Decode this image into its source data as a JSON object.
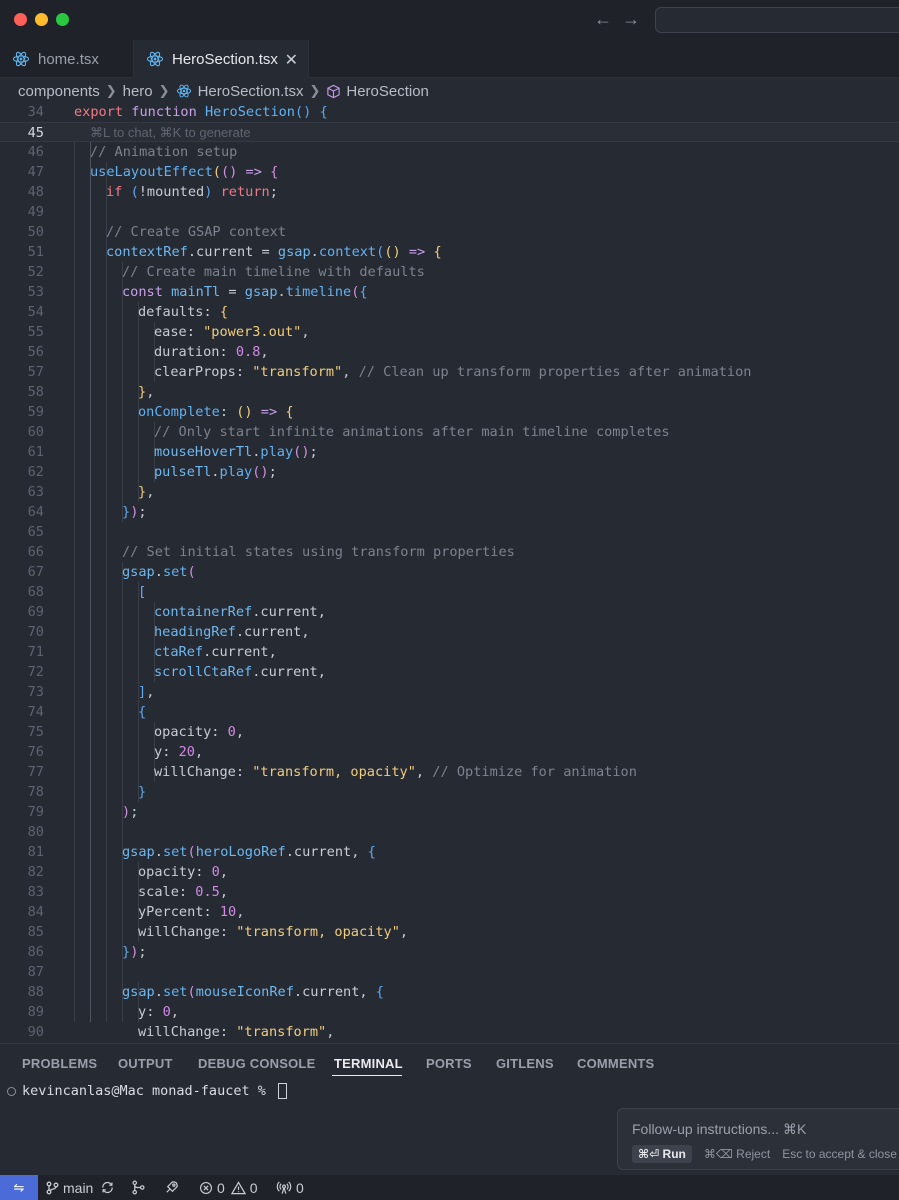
{
  "window": {
    "back_icon": "arrow-left-icon",
    "forward_icon": "arrow-right-icon"
  },
  "tabs": [
    {
      "label": "home.tsx",
      "icon": "react-icon"
    },
    {
      "label": "HeroSection.tsx",
      "icon": "react-icon",
      "close": "✕"
    }
  ],
  "breadcrumb": {
    "items": [
      "components",
      "hero",
      "HeroSection.tsx",
      "HeroSection"
    ]
  },
  "editor": {
    "inline_hint": "⌘L to chat, ⌘K to generate",
    "lines": [
      {
        "n": "34",
        "code": [
          [
            "ex",
            "export "
          ],
          [
            "kw",
            "function "
          ],
          [
            "fn",
            "HeroSection"
          ],
          [
            "br3",
            "() "
          ],
          [
            "br3",
            "{"
          ]
        ]
      },
      {
        "n": "45",
        "hint": true
      },
      {
        "n": "46",
        "code": [
          [
            "cm",
            "// Animation setup"
          ]
        ]
      },
      {
        "n": "47",
        "code": [
          [
            "fn",
            "useLayoutEffect"
          ],
          [
            "br1",
            "("
          ],
          [
            "br2",
            "("
          ],
          [
            "br2",
            ")"
          ],
          [
            "kw",
            " => "
          ],
          [
            "br2",
            "{"
          ]
        ]
      },
      {
        "n": "48",
        "code": [
          [
            "ex",
            "if "
          ],
          [
            "br3",
            "("
          ],
          [
            "pl",
            "!mounted"
          ],
          [
            "br3",
            ") "
          ],
          [
            "ex",
            "return"
          ],
          [
            "pl",
            ";"
          ]
        ]
      },
      {
        "n": "49",
        "code": []
      },
      {
        "n": "50",
        "code": [
          [
            "cm",
            "// Create GSAP context"
          ]
        ]
      },
      {
        "n": "51",
        "code": [
          [
            "va",
            "contextRef"
          ],
          [
            "pl",
            "."
          ],
          [
            "pr",
            "current"
          ],
          [
            "pl",
            " = "
          ],
          [
            "va",
            "gsap"
          ],
          [
            "pl",
            "."
          ],
          [
            "fn",
            "context"
          ],
          [
            "br3",
            "("
          ],
          [
            "br1",
            "("
          ],
          [
            "br1",
            ")"
          ],
          [
            "kw",
            " => "
          ],
          [
            "br1",
            "{"
          ]
        ]
      },
      {
        "n": "52",
        "code": [
          [
            "cm",
            "// Create main timeline with defaults"
          ]
        ]
      },
      {
        "n": "53",
        "code": [
          [
            "kw",
            "const "
          ],
          [
            "va",
            "mainTl"
          ],
          [
            "pl",
            " = "
          ],
          [
            "va",
            "gsap"
          ],
          [
            "pl",
            "."
          ],
          [
            "fn",
            "timeline"
          ],
          [
            "br2",
            "("
          ],
          [
            "br3",
            "{"
          ]
        ]
      },
      {
        "n": "54",
        "code": [
          [
            "pr",
            "defaults"
          ],
          [
            "pl",
            ": "
          ],
          [
            "br1",
            "{"
          ]
        ]
      },
      {
        "n": "55",
        "code": [
          [
            "pr",
            "ease"
          ],
          [
            "pl",
            ": "
          ],
          [
            "st",
            "\"power3.out\""
          ],
          [
            "pl",
            ","
          ]
        ]
      },
      {
        "n": "56",
        "code": [
          [
            "pr",
            "duration"
          ],
          [
            "pl",
            ": "
          ],
          [
            "nu",
            "0.8"
          ],
          [
            "pl",
            ","
          ]
        ]
      },
      {
        "n": "57",
        "code": [
          [
            "pr",
            "clearProps"
          ],
          [
            "pl",
            ": "
          ],
          [
            "st",
            "\"transform\""
          ],
          [
            "pl",
            ", "
          ],
          [
            "cm",
            "// Clean up transform properties after animation"
          ]
        ]
      },
      {
        "n": "58",
        "code": [
          [
            "br1",
            "}"
          ],
          [
            "pl",
            ","
          ]
        ]
      },
      {
        "n": "59",
        "code": [
          [
            "fn",
            "onComplete"
          ],
          [
            "pl",
            ": "
          ],
          [
            "br1",
            "("
          ],
          [
            "br1",
            ")"
          ],
          [
            "kw",
            " => "
          ],
          [
            "br1",
            "{"
          ]
        ]
      },
      {
        "n": "60",
        "code": [
          [
            "cm",
            "// Only start infinite animations after main timeline completes"
          ]
        ]
      },
      {
        "n": "61",
        "code": [
          [
            "va",
            "mouseHoverTl"
          ],
          [
            "pl",
            "."
          ],
          [
            "fn",
            "play"
          ],
          [
            "br2",
            "("
          ],
          [
            "br2",
            ")"
          ],
          [
            "pl",
            ";"
          ]
        ]
      },
      {
        "n": "62",
        "code": [
          [
            "va",
            "pulseTl"
          ],
          [
            "pl",
            "."
          ],
          [
            "fn",
            "play"
          ],
          [
            "br2",
            "("
          ],
          [
            "br2",
            ")"
          ],
          [
            "pl",
            ";"
          ]
        ]
      },
      {
        "n": "63",
        "code": [
          [
            "br1",
            "}"
          ],
          [
            "pl",
            ","
          ]
        ]
      },
      {
        "n": "64",
        "code": [
          [
            "br3",
            "}"
          ],
          [
            "br2",
            ")"
          ],
          [
            "pl",
            ";"
          ]
        ]
      },
      {
        "n": "65",
        "code": []
      },
      {
        "n": "66",
        "code": [
          [
            "cm",
            "// Set initial states using transform properties"
          ]
        ]
      },
      {
        "n": "67",
        "code": [
          [
            "va",
            "gsap"
          ],
          [
            "pl",
            "."
          ],
          [
            "fn",
            "set"
          ],
          [
            "br2",
            "("
          ]
        ]
      },
      {
        "n": "68",
        "code": [
          [
            "br3",
            "["
          ]
        ]
      },
      {
        "n": "69",
        "code": [
          [
            "va",
            "containerRef"
          ],
          [
            "pl",
            "."
          ],
          [
            "pr",
            "current"
          ],
          [
            "pl",
            ","
          ]
        ]
      },
      {
        "n": "70",
        "code": [
          [
            "va",
            "headingRef"
          ],
          [
            "pl",
            "."
          ],
          [
            "pr",
            "current"
          ],
          [
            "pl",
            ","
          ]
        ]
      },
      {
        "n": "71",
        "code": [
          [
            "va",
            "ctaRef"
          ],
          [
            "pl",
            "."
          ],
          [
            "pr",
            "current"
          ],
          [
            "pl",
            ","
          ]
        ]
      },
      {
        "n": "72",
        "code": [
          [
            "va",
            "scrollCtaRef"
          ],
          [
            "pl",
            "."
          ],
          [
            "pr",
            "current"
          ],
          [
            "pl",
            ","
          ]
        ]
      },
      {
        "n": "73",
        "code": [
          [
            "br3",
            "]"
          ],
          [
            "pl",
            ","
          ]
        ]
      },
      {
        "n": "74",
        "code": [
          [
            "br3",
            "{"
          ]
        ]
      },
      {
        "n": "75",
        "code": [
          [
            "pr",
            "opacity"
          ],
          [
            "pl",
            ": "
          ],
          [
            "nu",
            "0"
          ],
          [
            "pl",
            ","
          ]
        ]
      },
      {
        "n": "76",
        "code": [
          [
            "pr",
            "y"
          ],
          [
            "pl",
            ": "
          ],
          [
            "nu",
            "20"
          ],
          [
            "pl",
            ","
          ]
        ]
      },
      {
        "n": "77",
        "code": [
          [
            "pr",
            "willChange"
          ],
          [
            "pl",
            ": "
          ],
          [
            "st",
            "\"transform, opacity\""
          ],
          [
            "pl",
            ", "
          ],
          [
            "cm",
            "// Optimize for animation"
          ]
        ]
      },
      {
        "n": "78",
        "code": [
          [
            "br3",
            "}"
          ]
        ]
      },
      {
        "n": "79",
        "code": [
          [
            "br2",
            ")"
          ],
          [
            "pl",
            ";"
          ]
        ]
      },
      {
        "n": "80",
        "code": []
      },
      {
        "n": "81",
        "code": [
          [
            "va",
            "gsap"
          ],
          [
            "pl",
            "."
          ],
          [
            "fn",
            "set"
          ],
          [
            "br2",
            "("
          ],
          [
            "va",
            "heroLogoRef"
          ],
          [
            "pl",
            "."
          ],
          [
            "pr",
            "current"
          ],
          [
            "pl",
            ", "
          ],
          [
            "br3",
            "{"
          ]
        ]
      },
      {
        "n": "82",
        "code": [
          [
            "pr",
            "opacity"
          ],
          [
            "pl",
            ": "
          ],
          [
            "nu",
            "0"
          ],
          [
            "pl",
            ","
          ]
        ]
      },
      {
        "n": "83",
        "code": [
          [
            "pr",
            "scale"
          ],
          [
            "pl",
            ": "
          ],
          [
            "nu",
            "0.5"
          ],
          [
            "pl",
            ","
          ]
        ]
      },
      {
        "n": "84",
        "code": [
          [
            "pr",
            "yPercent"
          ],
          [
            "pl",
            ": "
          ],
          [
            "nu",
            "10"
          ],
          [
            "pl",
            ","
          ]
        ]
      },
      {
        "n": "85",
        "code": [
          [
            "pr",
            "willChange"
          ],
          [
            "pl",
            ": "
          ],
          [
            "st",
            "\"transform, opacity\""
          ],
          [
            "pl",
            ","
          ]
        ]
      },
      {
        "n": "86",
        "code": [
          [
            "br3",
            "}"
          ],
          [
            "br2",
            ")"
          ],
          [
            "pl",
            ";"
          ]
        ]
      },
      {
        "n": "87",
        "code": []
      },
      {
        "n": "88",
        "code": [
          [
            "va",
            "gsap"
          ],
          [
            "pl",
            "."
          ],
          [
            "fn",
            "set"
          ],
          [
            "br2",
            "("
          ],
          [
            "va",
            "mouseIconRef"
          ],
          [
            "pl",
            "."
          ],
          [
            "pr",
            "current"
          ],
          [
            "pl",
            ", "
          ],
          [
            "br3",
            "{"
          ]
        ]
      },
      {
        "n": "89",
        "code": [
          [
            "pr",
            "y"
          ],
          [
            "pl",
            ": "
          ],
          [
            "nu",
            "0"
          ],
          [
            "pl",
            ","
          ]
        ]
      },
      {
        "n": "90",
        "code": [
          [
            "pr",
            "willChange"
          ],
          [
            "pl",
            ": "
          ],
          [
            "st",
            "\"transform\""
          ],
          [
            "pl",
            ","
          ]
        ]
      }
    ]
  },
  "panel": {
    "tabs": [
      "PROBLEMS",
      "OUTPUT",
      "DEBUG CONSOLE",
      "TERMINAL",
      "PORTS",
      "GITLENS",
      "COMMENTS"
    ],
    "active_tab": "TERMINAL",
    "terminal_prompt": "kevincanlas@Mac monad-faucet % "
  },
  "followup": {
    "placeholder": "Follow-up instructions... ⌘K",
    "run_label": "⌘⏎ Run",
    "reject_label": "⌘⌫ Reject",
    "accept_label": "Esc to accept & close"
  },
  "statusbar": {
    "branch": "main",
    "errors": "0",
    "warnings": "0",
    "ports": "0"
  }
}
